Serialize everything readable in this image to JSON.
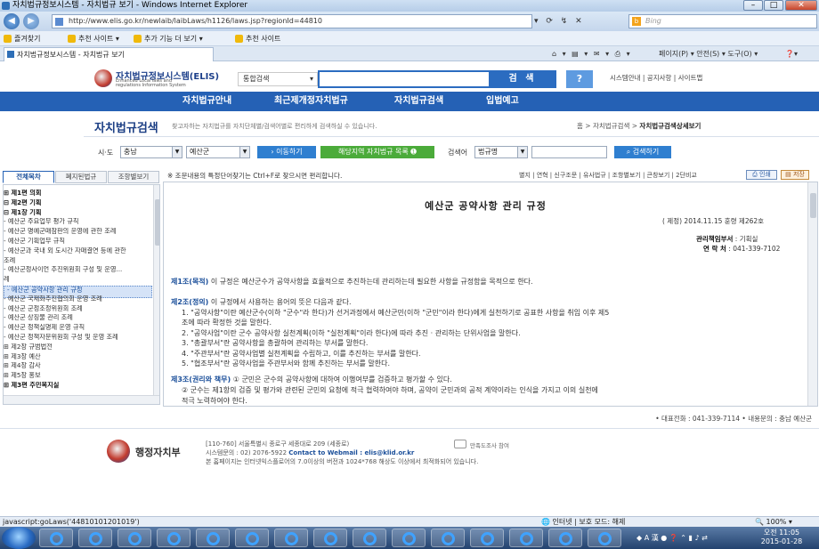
{
  "browser": {
    "window_title": "자치법규정보시스템 - 자치법규 보기 - Windows Internet Explorer",
    "url": "http://www.elis.go.kr/newlaib/laibLaws/h1126/laws.jsp?regionId=44810",
    "search_placeholder": "Bing",
    "favorites_label": "즐겨찾기",
    "fav_items": [
      "추천 사이트 ▾",
      "추가 기능 더 보기 ▾",
      "추천 사이트"
    ],
    "tab_title": "자치법규정보시스템 - 자치법규 보기",
    "command_bar": "페이지(P) ▾  안전(S) ▾  도구(O) ▾",
    "status_text": "javascript:goLaws('448101012010​19')",
    "zone_text": "인터넷 | 보호 모드: 해제",
    "zoom_text": "100%",
    "clock_time": "오전 11:05",
    "clock_date": "2015-01-28"
  },
  "site": {
    "logo_title": "자치법규정보시스템(ELIS)",
    "logo_sub": "Enhanced Local laws and regulations Information System",
    "search_scope": "통합검색",
    "search_button": "검 색",
    "help_button": "?",
    "top_links": "시스템안내 | 공지사항 | 사이트맵",
    "nav": [
      "자치법규안내",
      "최근제개정자치법규",
      "자치법규검색",
      "입법예고"
    ],
    "page_title": "자치법규검색",
    "page_desc": "찾고자하는 자치법규를 자치단체별/검색어별로 편리하게 검색하실 수 있습니다.",
    "breadcrumb_prefix": "홈 >  자치법규검색 >",
    "breadcrumb_current": "자치법규검색상세보기"
  },
  "filter": {
    "sido_label": "시·도",
    "sido_value": "충남",
    "sigungu_value": "예산군",
    "move_button": "› 이동하기",
    "region_button": "해당지역 자치법규 목록 ➊",
    "keyword_label": "검색어",
    "keyword_field": "법규명",
    "keyword_button": "⌕ 검색하기"
  },
  "left_tabs": [
    "전체목차",
    "폐지된법규",
    "조항별보기"
  ],
  "hint": "※ 조문내용의 특정단어찾기는 Ctrl+F로 찾으시면 편리합니다.",
  "tools": "별지 | 연혁 | 신구조문 | 유사법규 | 조항별보기 | 큰창보기 | 2단비교",
  "print_button": "⎙ 인쇄",
  "save_button": "▤ 저장",
  "tree": [
    {
      "text": "⊞ 제1편 의회",
      "bold": true
    },
    {
      "text": "⊟ 제2편 기획",
      "bold": true
    },
    {
      "text": "  ⊟ 제1장 기획",
      "bold": true
    },
    {
      "text": "    - 예산군 주요업무 평가 규칙",
      "bold": false
    },
    {
      "text": "    - 예산군 명예군매참판의 운영에 관한 조례",
      "bold": false
    },
    {
      "text": "    - 예산군 기획업무 규칙",
      "bold": false
    },
    {
      "text": "    - 예산군과 국내 외 도시간 자매결연 등에 관한",
      "bold": false
    },
    {
      "text": "      조례",
      "bold": false
    },
    {
      "text": "    - 예산군정사이언 추진위원회 구성 및 운영...",
      "bold": false
    },
    {
      "text": "      례",
      "bold": false
    },
    {
      "text": "    - 예산군 공약사항 관리 규정",
      "bold": false,
      "selected": true
    },
    {
      "text": "    - 예산군 국제화추진협의회 운영 조례",
      "bold": false
    },
    {
      "text": "    - 예산군 군정조정위원회 조례",
      "bold": false
    },
    {
      "text": "    - 예산군 상징물 관리 조례",
      "bold": false
    },
    {
      "text": "    - 예산군 정책실명제 운영 규칙",
      "bold": false
    },
    {
      "text": "    - 예산군 정책자문위원회 구성 및 운영 조례",
      "bold": false
    },
    {
      "text": "  ⊞ 제2장 규범법전",
      "bold": false
    },
    {
      "text": "  ⊞ 제3장 예산",
      "bold": false
    },
    {
      "text": "  ⊞ 제4장 감사",
      "bold": false
    },
    {
      "text": "  ⊞ 제5장 홍보",
      "bold": false
    },
    {
      "text": "⊞ 제3편 주민복지실",
      "bold": true
    }
  ],
  "doc": {
    "title": "예산군 공약사항 관리 규정",
    "enact": "(     제정) 2014.11.15 훈령 제262호",
    "dept_label": "관리책임부서",
    "dept_value": ":  기획실",
    "phone_label": "연 락 처",
    "phone_value": ":  041-339-7102",
    "lines": [
      {
        "art": "제1조(목적)",
        "text": "  이 규정은 예산군수가 공약사항을 효율적으로 추진하는데 관리하는데 필요한 사항을 규정함을 목적으로 한다.",
        "indent": false
      },
      {
        "art": "제2조(정의)",
        "text": "  이 규정에서 사용하는 용어의 뜻은 다음과 같다.",
        "indent": false
      },
      {
        "art": "",
        "text": "1. \"공약사항\"이란 예산군수(이하 \"군수\"라 한다)가 선거과정에서 예산군민(이하 \"군민\"이라 한다)에게 실천하기로 공표한 사항을 취임 이후 제5",
        "indent": true
      },
      {
        "art": "",
        "text": "   조에 따라 확정한 것을 말한다.",
        "indent": true
      },
      {
        "art": "",
        "text": "2. \"공약사업\"이란 군수 공약사항 실천계획(이하 \"실천계획\"이라 한다)에 따라 추진 · 관리하는 단위사업을 말한다.",
        "indent": true
      },
      {
        "art": "",
        "text": "3. \"총괄부서\"란 공약사항을 총괄하여 관리하는 부서를 말한다.",
        "indent": true
      },
      {
        "art": "",
        "text": "4. \"주관부서\"란 공약사업별 실천계획을 수립하고, 이를 추진하는 부서를 말한다.",
        "indent": true
      },
      {
        "art": "",
        "text": "5. \"협조부서\"란 공약사업을 주관부서와 함께 추진하는 부서를 말한다.",
        "indent": true
      },
      {
        "art": "제3조(권리와 책무)",
        "text": "  ① 군민은 군수의 공약사항에 대하여 이행여부를 검증하고 평가할 수 있다.",
        "indent": false
      },
      {
        "art": "",
        "text": "② 군수는 제1항의 검증 및 평가와 관련된 군민의 요청에 적극 협력하여야 하며, 공약이 군민과의 공적 계약이라는 인식을 가지고 이의 실천에",
        "indent": true
      },
      {
        "art": "",
        "text": "적극 노력하여야 한다.",
        "indent": true
      }
    ]
  },
  "footer": {
    "contact": "• 대표전화 : 041-339-7114   • 내용문의 : 충남 예산군",
    "org_name": "행정자치부",
    "addr1": "[110-760] 서울특별시 종로구 세종대로 209 (세종로)",
    "addr2_prefix": "시스템문의 : 02) 2076-5922",
    "addr2_link": "Contact to Webmail : elis@klid.or.kr",
    "addr3": "본 홈페이지는 인터넷익스플로어의 7.0이상의 버전과 1024*768 해상도 이상에서 최적화되어 있습니다.",
    "survey": "만족도조사 참여"
  },
  "colors": {
    "nav_bg": "#2561b5",
    "accent": "#1b4f9a",
    "green_button": "#4bab3a"
  }
}
